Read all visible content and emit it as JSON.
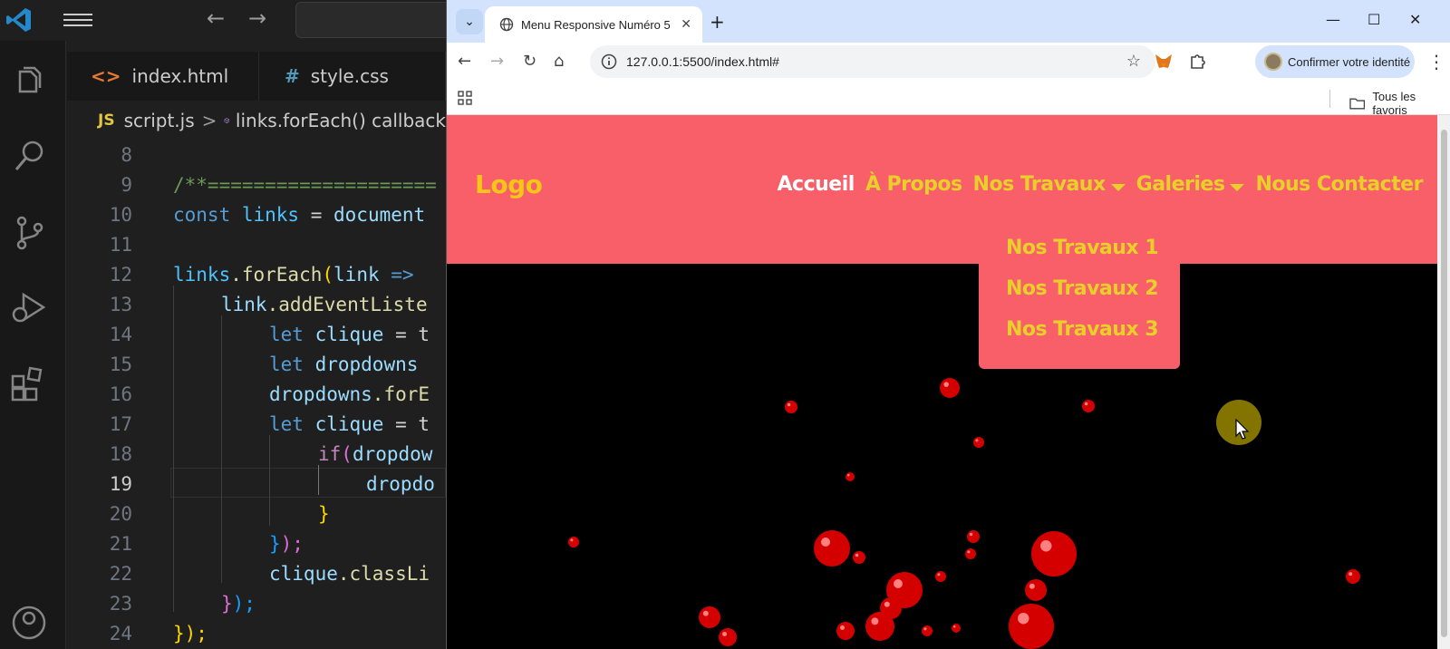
{
  "vscode": {
    "tabs": [
      {
        "icon": "<>",
        "label": "index.html"
      },
      {
        "icon": "#",
        "label": "style.css"
      }
    ],
    "breadcrumb": {
      "file_icon": "JS",
      "file": "script.js",
      "separator": ">",
      "symbol": "links.forEach() callback"
    },
    "active_line": 19,
    "lines": [
      {
        "num": "8"
      },
      {
        "num": "9"
      },
      {
        "num": "10"
      },
      {
        "num": "11"
      },
      {
        "num": "12"
      },
      {
        "num": "13"
      },
      {
        "num": "14"
      },
      {
        "num": "15"
      },
      {
        "num": "16"
      },
      {
        "num": "17"
      },
      {
        "num": "18"
      },
      {
        "num": "19"
      },
      {
        "num": "20"
      },
      {
        "num": "21"
      },
      {
        "num": "22"
      },
      {
        "num": "23"
      },
      {
        "num": "24"
      }
    ],
    "code": {
      "l9": "/**====================",
      "l10_kw": "const",
      "l10_var": " links",
      "l10_rest": " = ",
      "l10_obj": "document",
      "l12_obj": "links",
      "l12_fn": ".forEach",
      "l12_paren": "(",
      "l12_param": "link",
      "l12_arrow": " =>",
      "l13_obj": "link",
      "l13_fn": ".addEventListe",
      "l14_kw": "let",
      "l14_var": " clique",
      "l14_rest": " = t",
      "l15_kw": "let",
      "l15_var": " dropdowns",
      "l16_obj": "dropdowns",
      "l16_fn": ".forE",
      "l17_kw": "let",
      "l17_var": " clique",
      "l17_rest": " = t",
      "l18_ctl": "if",
      "l18_paren": "(",
      "l18_var": "dropdow",
      "l19_var": "dropdo",
      "l20": "}",
      "l21_a": "}",
      "l21_b": ");",
      "l22_obj": "clique",
      "l22_fn": ".classLi",
      "l23_a": "}",
      "l23_b": ");",
      "l24": "});"
    }
  },
  "chrome": {
    "tab_title": "Menu Responsive Numéro 5",
    "tab_close": "✕",
    "new_tab": "+",
    "tablist_icon": "⌄",
    "window_controls": {
      "minimize": "—",
      "maximize": "☐",
      "close": "✕"
    },
    "url": "127.0.0.1:5500/index.html#",
    "identity_label": "Confirmer votre identité",
    "bookmarks_all": "Tous les favoris",
    "nav": {
      "back": "←",
      "forward": "→",
      "reload": "↻",
      "home": "⌂",
      "star": "☆",
      "more": "⋮"
    }
  },
  "site": {
    "logo": "Logo",
    "nav": [
      {
        "label": "Accueil",
        "active": true,
        "dropdown": false
      },
      {
        "label": "À Propos",
        "active": false,
        "dropdown": false
      },
      {
        "label": "Nos Travaux",
        "active": false,
        "dropdown": true
      },
      {
        "label": "Galeries",
        "active": false,
        "dropdown": true
      },
      {
        "label": "Nous Contacter",
        "active": false,
        "dropdown": false
      }
    ],
    "dropdown_items": [
      "Nos Travaux 1",
      "Nos Travaux 2",
      "Nos Travaux 3"
    ],
    "colors": {
      "header_bg": "#f85f68",
      "logo": "#f5c518",
      "link": "#e8cf2a",
      "active_link": "#ffffff",
      "hero_bg": "#000000",
      "droplet": "#d40000"
    }
  }
}
